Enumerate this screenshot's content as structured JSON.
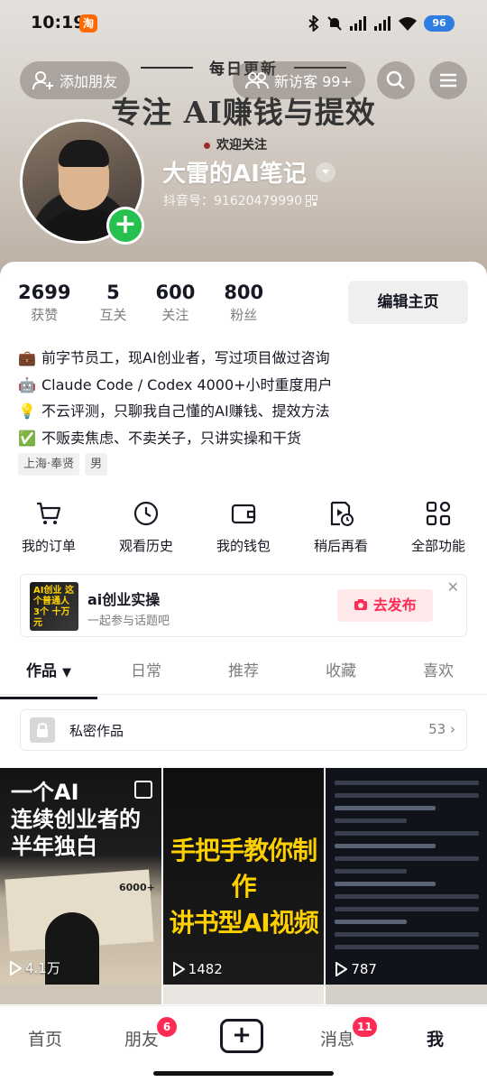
{
  "status_bar": {
    "time": "10:19",
    "app_icon": "淘",
    "battery": "96"
  },
  "banner": {
    "top_text": "每日更新",
    "main_text": "专注 AI赚钱与提效",
    "sub_text": "欢迎关注"
  },
  "header": {
    "add_friend_label": "添加朋友",
    "visitors_label": "新访客 99+"
  },
  "profile": {
    "nickname": "大雷的AI笔记",
    "douyin_id": "抖音号：91620479990"
  },
  "stats": [
    {
      "num": "2699",
      "label": "获赞"
    },
    {
      "num": "5",
      "label": "互关"
    },
    {
      "num": "600",
      "label": "关注"
    },
    {
      "num": "800",
      "label": "粉丝"
    }
  ],
  "edit_button": "编辑主页",
  "bio": [
    {
      "emoji": "💼",
      "text": "前字节员工，现AI创业者，写过项目做过咨询"
    },
    {
      "emoji": "🤖",
      "text": "Claude Code / Codex 4000+小时重度用户"
    },
    {
      "emoji": "💡",
      "text": "不云评测，只聊我自己懂的AI赚钱、提效方法"
    },
    {
      "emoji": "✅",
      "text": "不贩卖焦虑、不卖关子，只讲实操和干货"
    }
  ],
  "tags": [
    "上海·奉贤",
    "男"
  ],
  "shortcuts": [
    {
      "label": "我的订单",
      "icon": "cart-icon"
    },
    {
      "label": "观看历史",
      "icon": "clock-icon"
    },
    {
      "label": "我的钱包",
      "icon": "wallet-icon"
    },
    {
      "label": "稍后再看",
      "icon": "watch-later-icon"
    },
    {
      "label": "全部功能",
      "icon": "grid-icon"
    }
  ],
  "topic": {
    "title": "ai创业实操",
    "subtitle": "一起参与话题吧",
    "publish_label": "去发布",
    "thumb_text": "AI创业 这个普通人 3个 十万元"
  },
  "tabs": [
    "作品",
    "日常",
    "推荐",
    "收藏",
    "喜欢"
  ],
  "private_works": {
    "label": "私密作品",
    "count": "53"
  },
  "videos": [
    {
      "title_lines": [
        "一个AI",
        "连续创业者的",
        "半年独白"
      ],
      "extra": "6000+",
      "views": "4.1万"
    },
    {
      "title_lines": [
        "手把手教你制作",
        "讲书型AI视频"
      ],
      "views": "1482"
    },
    {
      "views": "787"
    }
  ],
  "bottom_nav": {
    "home": "首页",
    "friends": "朋友",
    "friends_badge": "6",
    "plus": "+",
    "messages": "消息",
    "messages_badge": "11",
    "me": "我"
  },
  "colors": {
    "accent_red": "#fe2c55",
    "follow_green": "#25c04d",
    "topic_yellow": "#ffd000"
  }
}
